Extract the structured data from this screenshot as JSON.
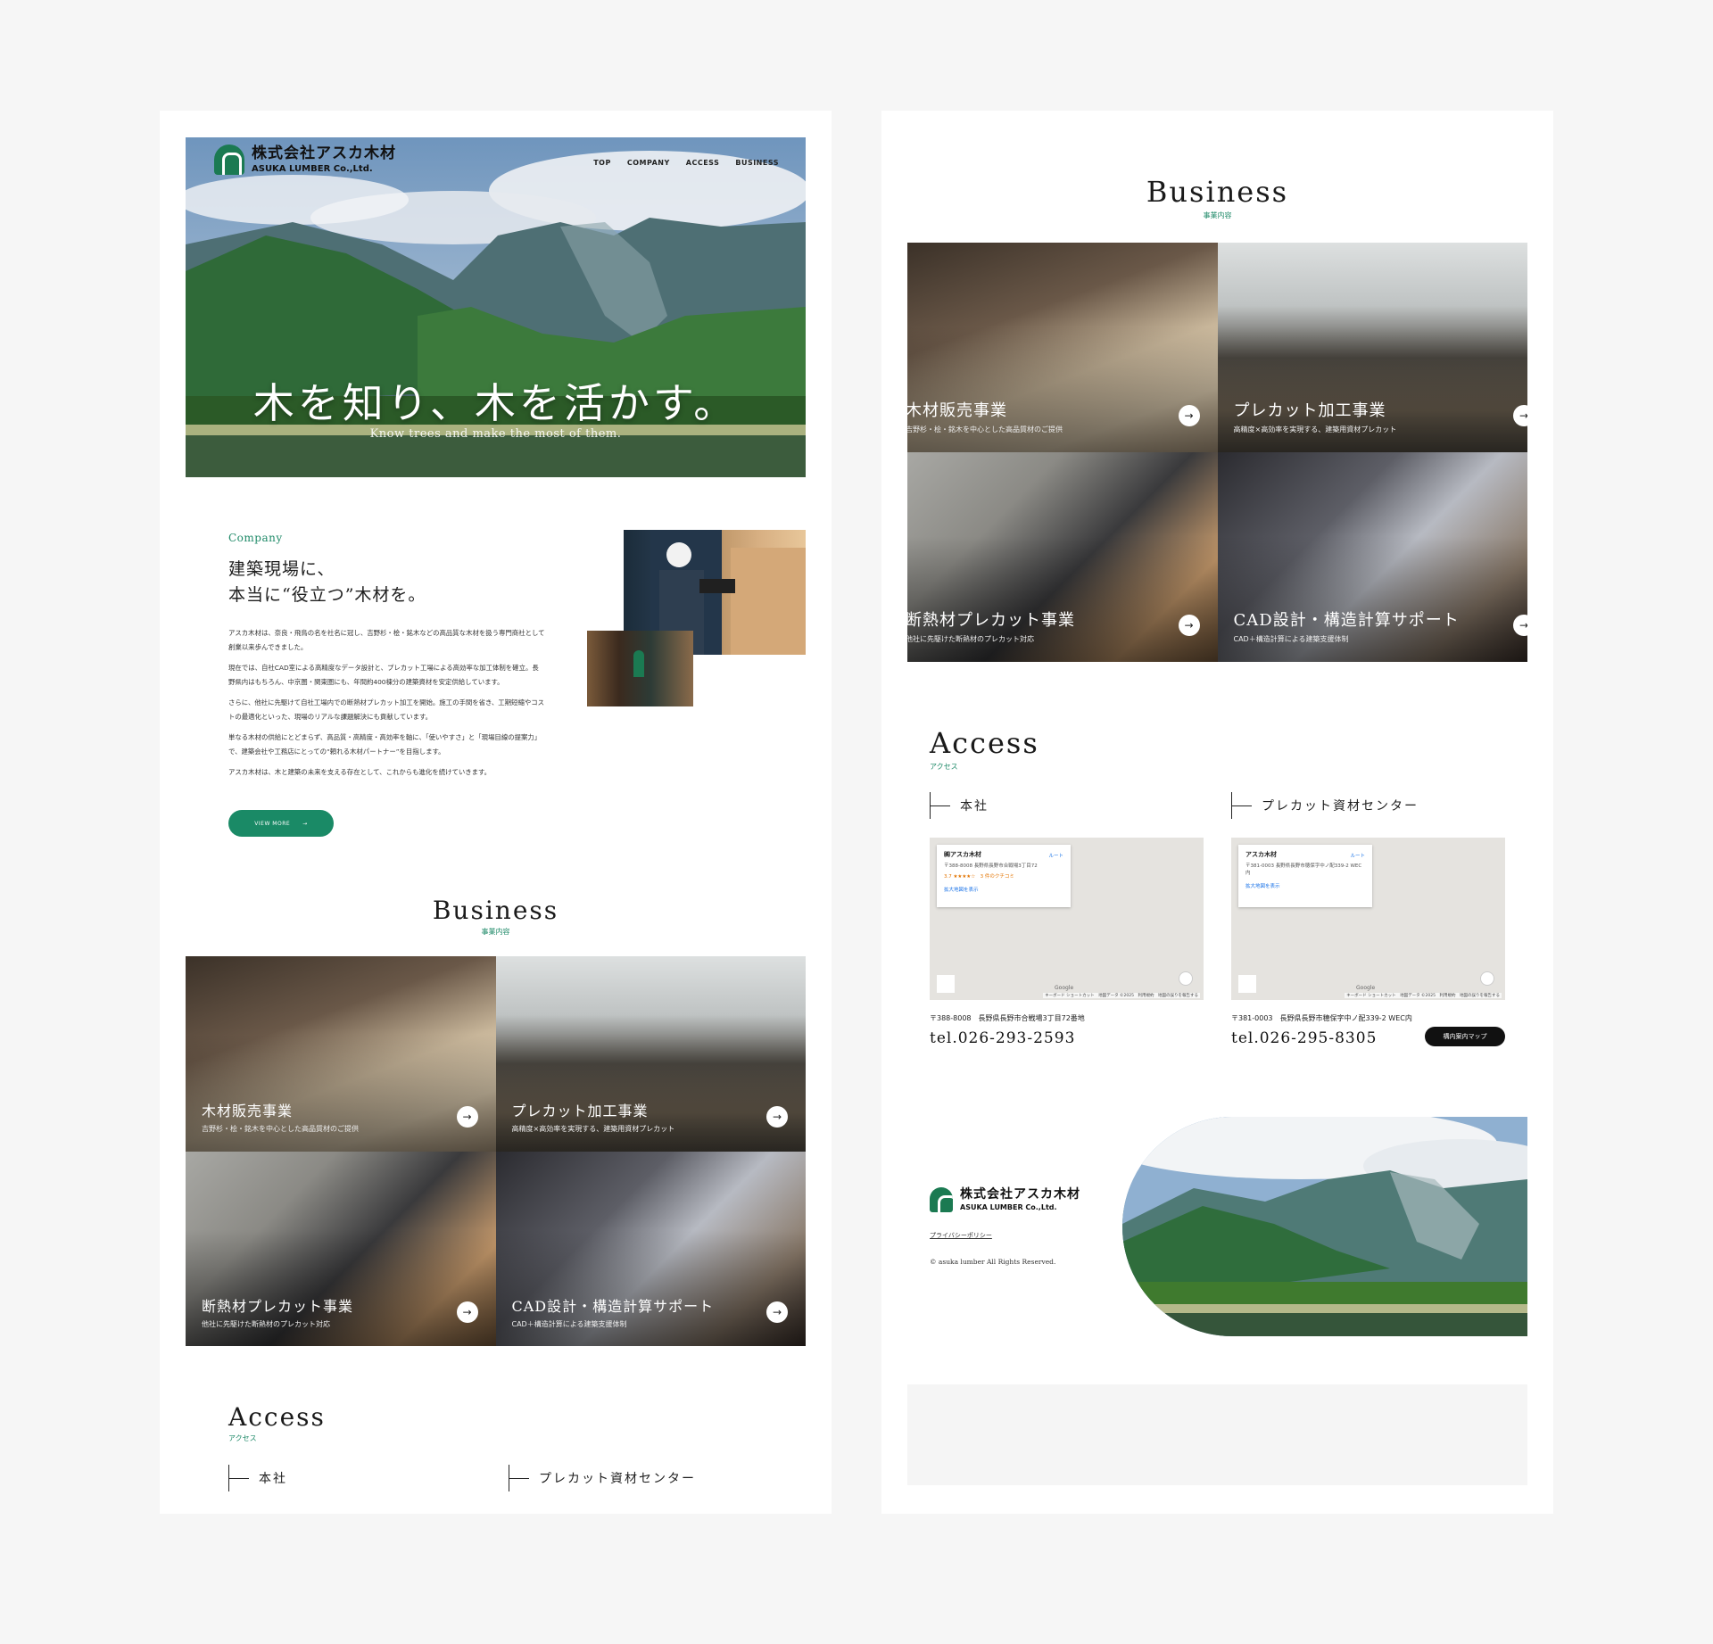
{
  "header": {
    "logo_jp": "株式会社アスカ木材",
    "logo_en": "ASUKA LUMBER Co.,Ltd.",
    "logo_mark_text": "ASUKA",
    "nav": [
      "TOP",
      "COMPANY",
      "ACCESS",
      "BUSINESS"
    ]
  },
  "hero": {
    "title": "木を知り、木を活かす。",
    "subtitle": "Know trees and make the most of them."
  },
  "company": {
    "label": "Company",
    "heading_line1": "建築現場に、",
    "heading_line2": "本当に“役立つ”木材を。",
    "paragraphs": [
      "アスカ木材は、奈良・飛鳥の名を社名に冠し、吉野杉・桧・銘木などの高品質な木材を扱う専門商社として創業以来歩んできました。",
      "現在では、自社CAD室による高精度なデータ設計と、プレカット工場による高効率な加工体制を確立。長野県内はもちろん、中京圏・関東圏にも、年間約400棟分の建築資材を安定供給しています。",
      "さらに、他社に先駆けて自社工場内での断熱材プレカット加工を開始。施工の手間を省き、工期短縮やコストの最適化といった、現場のリアルな課題解決にも貢献しています。",
      "単なる木材の供給にとどまらず、高品質・高精度・高効率を軸に、「使いやすさ」と「現場目線の提案力」で、建築会社や工務店にとっての“頼れる木材パートナー”を目指します。",
      "アスカ木材は、木と建築の未来を支える存在として、これからも進化を続けていきます。"
    ],
    "view_more": "VIEW MORE",
    "view_more_arrow": "→"
  },
  "business": {
    "title": "Business",
    "subtitle": "事業内容",
    "items": [
      {
        "title": "木材販売事業",
        "desc": "吉野杉・桧・銘木を中心とした高品質材のご提供"
      },
      {
        "title": "プレカット加工事業",
        "desc": "高精度×高効率を実現する、建築用資材プレカット"
      },
      {
        "title": "断熱材プレカット事業",
        "desc": "他社に先駆けた断熱材のプレカット対応"
      },
      {
        "title": "CAD設計・構造計算サポート",
        "desc": "CAD＋構造計算による建築支援体制"
      }
    ],
    "arrow": "→"
  },
  "access": {
    "title": "Access",
    "subtitle": "アクセス",
    "branches": [
      {
        "name": "本社",
        "map_name": "㈱アスカ木材",
        "map_addr": "〒388-8008 長野県長野市合戦場3丁目72",
        "map_rating": "3.7 ★★★★☆　3 件のクチコミ",
        "map_link": "拡大地図を表示",
        "map_route": "ルート",
        "address": "〒388-8008　長野県長野市合戦場3丁目72番地",
        "tel": "tel.026-293-2593"
      },
      {
        "name": "プレカット資材センター",
        "map_name": "アスカ木材",
        "map_addr": "〒381-0003 長野県長野市穂保字中ノ配339-2 WEC内",
        "map_link": "拡大地図を表示",
        "map_route": "ルート",
        "address": "〒381-0003　長野県長野市穂保字中ノ配339-2 WEC内",
        "tel": "tel.026-295-8305",
        "guide_button": "構内案内マップ"
      }
    ],
    "map_google": "Google",
    "map_attribution": "キーボード ショートカット　地図データ ©2025　利用規約　地図の誤りを報告する"
  },
  "footer": {
    "privacy": "プライバシーポリシー",
    "copyright": "© asuka lumber All Rights Reserved."
  }
}
